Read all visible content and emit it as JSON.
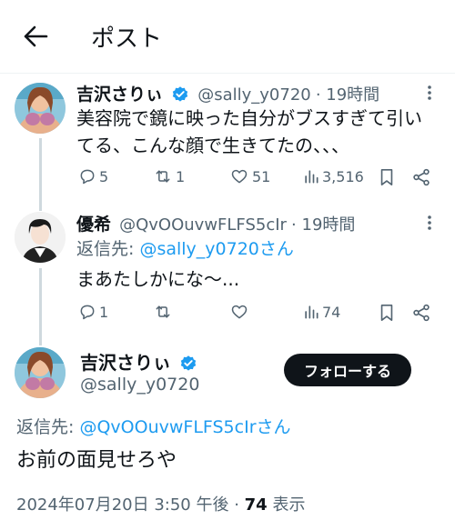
{
  "header": {
    "title": "ポスト"
  },
  "post1": {
    "name": "吉沢さりぃ",
    "handle": "@sally_y0720",
    "time": "· 19時間",
    "text_line1": "美容院で鏡に映った自分がブスすぎて引い",
    "text_line2": "てる、こんな顔で生きてたの、、、",
    "replies": "5",
    "reposts": "1",
    "likes": "51",
    "views": "3,516"
  },
  "post2": {
    "name": "優希",
    "handle": "@QvOOuvwFLFS5cIr",
    "time": "· 19時間",
    "reply_to_label": "返信先:",
    "reply_to_handle": "@sally_y0720さん",
    "text": "まあたしかにな〜...",
    "replies": "1",
    "reposts": "",
    "likes": "",
    "views": "74"
  },
  "main_post": {
    "name": "吉沢さりぃ",
    "handle": "@sally_y0720",
    "follow_label": "フォローする",
    "reply_to_label": "返信先:",
    "reply_to_handle": "@QvOOuvwFLFS5cIrさん",
    "text": "お前の面見せろや",
    "timestamp": "2024年07月20日 3:50 午後 · ",
    "view_count": "74",
    "view_label": " 表示"
  },
  "colors": {
    "accent": "#1d9bf0",
    "muted": "#536471",
    "text": "#0f1419",
    "button": "#0f1419"
  }
}
